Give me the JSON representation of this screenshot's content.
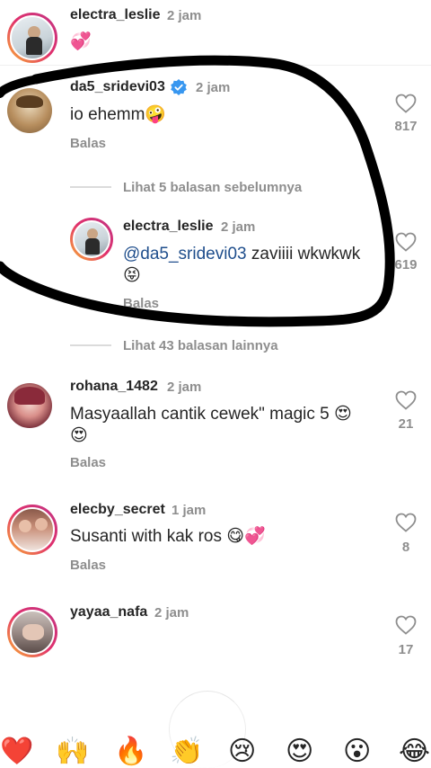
{
  "comments": [
    {
      "username": "electra_leslie",
      "time": "2 jam",
      "text": "💞",
      "likes": ""
    },
    {
      "username": "da5_sridevi03",
      "time": "2 jam",
      "text": "io ehemm🤪",
      "reply": "Balas",
      "likes": "817",
      "verified": true
    },
    {
      "username": "electra_leslie",
      "time": "2 jam",
      "mention": "@da5_sridevi03",
      "text": " zaviiii wkwkwk",
      "text2": "😝",
      "reply": "Balas",
      "likes": "619"
    },
    {
      "username": "rohana_1482",
      "time": "2 jam",
      "text": "Masyaallah cantik cewek\" magic 5 😍",
      "text2": "😍",
      "reply": "Balas",
      "likes": "21"
    },
    {
      "username": "elecby_secret",
      "time": "1 jam",
      "text": "Susanti with kak ros 😋💞",
      "reply": "Balas",
      "likes": "8"
    },
    {
      "username": "yayaa_nafa",
      "time": "2 jam",
      "likes": "17"
    }
  ],
  "threads": {
    "previous_replies": "Lihat 5 balasan sebelumnya",
    "more_replies": "Lihat 43 balasan lainnya"
  },
  "emoji_bar": [
    "❤️",
    "🙌",
    "🔥",
    "👏",
    "😢",
    "😍",
    "😮",
    "😂"
  ],
  "colors": {
    "annotation_stroke": "#000000",
    "mention": "#1f4e8c",
    "muted": "#8e8e8e"
  }
}
